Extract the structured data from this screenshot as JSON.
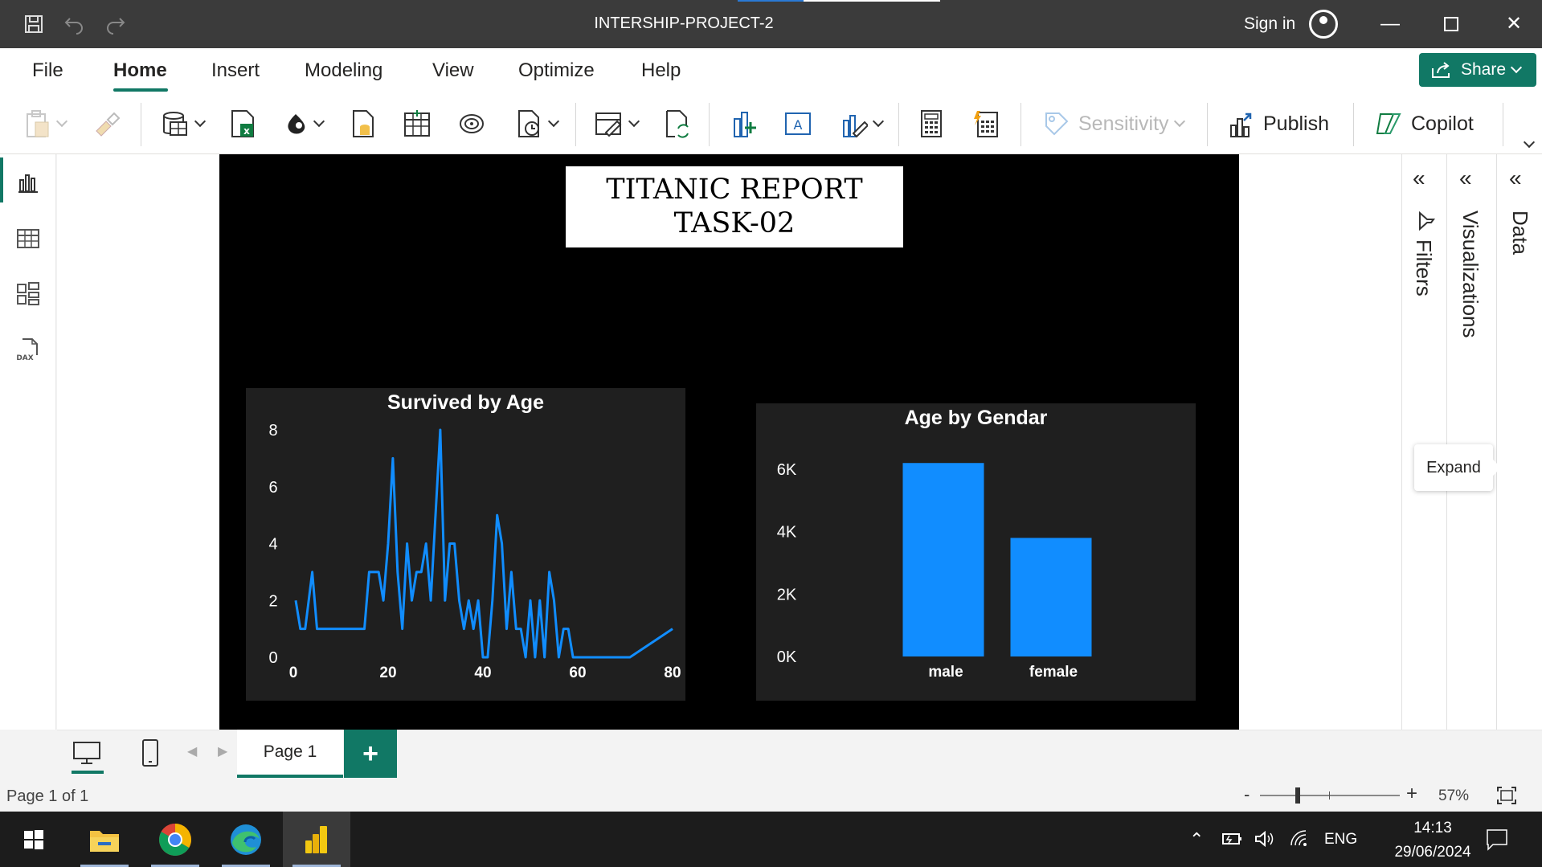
{
  "window": {
    "title": "INTERSHIP-PROJECT-2",
    "sign_in": "Sign in"
  },
  "menu": {
    "items": [
      "File",
      "Home",
      "Insert",
      "Modeling",
      "View",
      "Optimize",
      "Help"
    ],
    "active": "Home",
    "share": "Share"
  },
  "ribbon": {
    "sensitivity": "Sensitivity",
    "publish": "Publish",
    "copilot": "Copilot"
  },
  "report": {
    "title_line1": "TITANIC REPORT",
    "title_line2": "TASK-02"
  },
  "panes": {
    "filters": "Filters",
    "visualizations": "Visualizations",
    "data": "Data",
    "expand_tooltip": "Expand"
  },
  "pages": {
    "tab": "Page 1",
    "add": "+",
    "status": "Page 1 of 1",
    "zoom": "57%"
  },
  "taskbar": {
    "lang": "ENG",
    "time": "14:13",
    "date": "29/06/2024"
  },
  "chart_data": [
    {
      "type": "line",
      "title": "Survived by Age",
      "xlabel": "",
      "ylabel": "",
      "xlim": [
        0,
        80
      ],
      "ylim": [
        0,
        8
      ],
      "x_ticks": [
        "0",
        "20",
        "40",
        "60",
        "80"
      ],
      "y_ticks": [
        "0",
        "2",
        "4",
        "6",
        "8"
      ],
      "color": "#118DFF",
      "series": [
        {
          "x": [
            0.5,
            1.5,
            2.5,
            4,
            5,
            6,
            7,
            8,
            9,
            10,
            11,
            12,
            13,
            14,
            15,
            16,
            17,
            18,
            19,
            20,
            21,
            22,
            23,
            24,
            25,
            26,
            27,
            28,
            29,
            30,
            31,
            32,
            33,
            34,
            35,
            36,
            37,
            38,
            39,
            40,
            41,
            42,
            43,
            44,
            45,
            46,
            47,
            48,
            49,
            50,
            51,
            52,
            53,
            54,
            55,
            56,
            57,
            58,
            59,
            60,
            61,
            62,
            63,
            64,
            65,
            70,
            71,
            80
          ],
          "values": [
            2,
            1,
            1,
            3,
            1,
            1,
            1,
            1,
            1,
            1,
            1,
            1,
            1,
            1,
            1,
            3,
            3,
            3,
            2,
            4,
            7,
            3,
            1,
            4,
            2,
            3,
            3,
            4,
            2,
            5,
            8,
            2,
            4,
            4,
            2,
            1,
            2,
            1,
            2,
            0,
            0,
            2,
            5,
            4,
            1,
            3,
            1,
            1,
            0,
            2,
            0,
            2,
            0,
            3,
            2,
            0,
            1,
            1,
            0,
            0,
            0,
            0,
            0,
            0,
            0,
            0,
            0,
            1
          ]
        }
      ]
    },
    {
      "type": "bar",
      "title": "Age by Gendar",
      "xlabel": "",
      "ylabel": "",
      "categories": [
        "male",
        "female"
      ],
      "values": [
        6200,
        3800
      ],
      "ylim": [
        0,
        6000
      ],
      "y_ticks": [
        "0K",
        "2K",
        "4K",
        "6K"
      ],
      "color": "#118DFF"
    }
  ]
}
